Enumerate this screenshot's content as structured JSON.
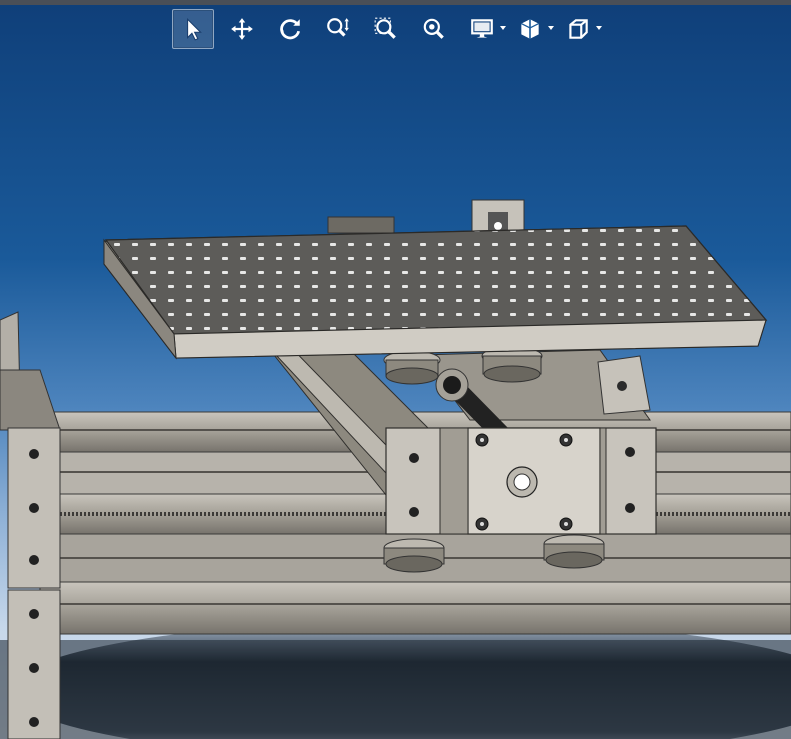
{
  "window": {
    "title": "",
    "view_background": "#1a5a9a"
  },
  "toolbar": {
    "tools": [
      {
        "icon": "select-arrow-icon",
        "active": true
      },
      {
        "icon": "pan-move-icon",
        "active": false
      },
      {
        "icon": "rotate-view-icon",
        "active": false
      },
      {
        "icon": "zoom-in-out-icon",
        "active": false
      },
      {
        "icon": "zoom-to-area-icon",
        "active": false
      },
      {
        "icon": "zoom-to-fit-icon",
        "active": false
      },
      {
        "icon": "display-style-icon",
        "active": false,
        "dropdown": true
      },
      {
        "icon": "section-view-icon",
        "active": false,
        "dropdown": true
      },
      {
        "icon": "view-orientation-cube-icon",
        "active": false,
        "dropdown": true
      }
    ]
  },
  "model": {
    "description_colors": {
      "steel": "#a9a49a",
      "steel_dark": "#6f6b63",
      "plate_top": "#5b5a58",
      "highlight": "#d9d6cf"
    }
  }
}
